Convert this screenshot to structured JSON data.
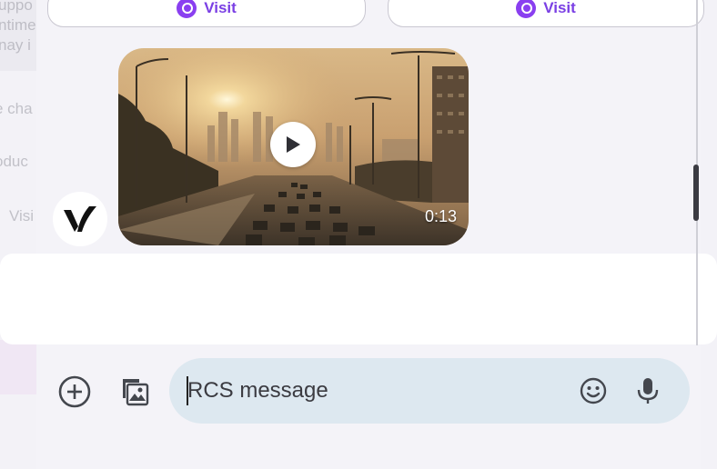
{
  "background": {
    "ghost_texts": [
      "uppo",
      "ntime",
      "nay i",
      "e cha",
      "oduc",
      "Visi"
    ]
  },
  "suggestions": [
    {
      "label": "Visit",
      "icon": "link-icon"
    },
    {
      "label": "Visit",
      "icon": "link-icon"
    }
  ],
  "message": {
    "sender_logo": "V",
    "video": {
      "duration": "0:13",
      "icon": "play-icon"
    }
  },
  "composer": {
    "placeholder": "RCS message",
    "icons": [
      "add-circle-icon",
      "gallery-icon",
      "emoji-icon",
      "microphone-icon"
    ]
  },
  "colors": {
    "accent": "#8a3ff0",
    "input_bg": "#dde8f0",
    "sheet_bg": "#f4f3f8"
  }
}
